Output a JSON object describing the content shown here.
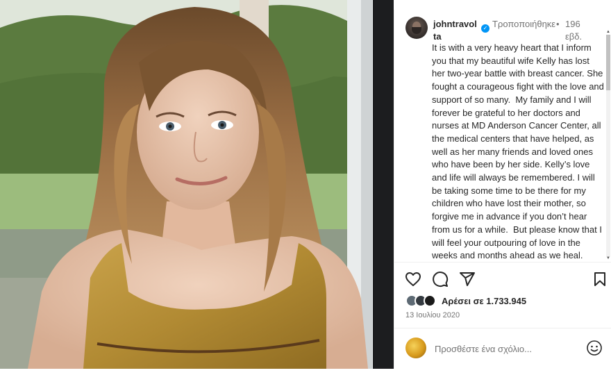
{
  "post": {
    "username": "johntravolta",
    "edited_label": "Τροποποιήθηκε",
    "separator": "•",
    "age": "196 εβδ.",
    "caption": "It is with a very heavy heart that I inform you that my beautiful wife Kelly has lost her two-year battle with breast cancer. She fought a courageous fight with the love and support of so many.  My family and I will forever be grateful to her doctors and nurses at MD Anderson Cancer Center, all the medical centers that have helped, as well as her many friends and loved ones who have been by her side. Kelly’s love and life will always be remembered. I will be taking some time to be there for my children who have lost their mother, so forgive me in advance if you don’t hear from us for a while.  But please know that I will feel your outpouring of love in the weeks and months ahead as we heal.",
    "likes": "Αρέσει σε 1.733.945",
    "date": "13 Ιουλίου 2020"
  },
  "comment": {
    "placeholder": "Προσθέστε ένα σχόλιο..."
  },
  "icons": {
    "like": "heart-icon",
    "comment": "comment-icon",
    "share": "send-icon",
    "save": "bookmark-icon",
    "emoji": "smiley-icon",
    "verified": "verified-badge-icon"
  },
  "colors": {
    "verified": "#0095f6",
    "text": "#262626",
    "secondary": "#737373"
  }
}
